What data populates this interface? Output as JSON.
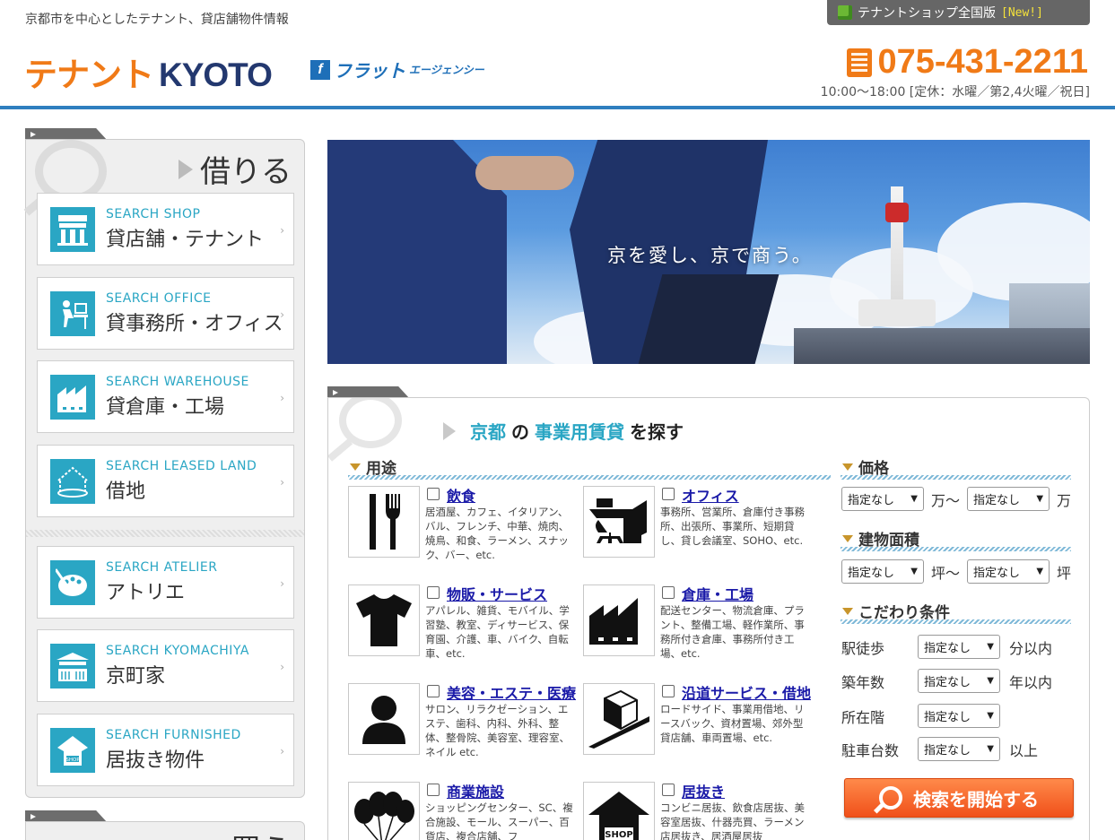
{
  "header": {
    "tagline": "京都市を中心としたテナント、貸店舗物件情報",
    "ribbon_label": "テナントショップ全国版",
    "ribbon_new": "[New!]",
    "logo_tenant": "テナント",
    "logo_kyoto": "KYOTO",
    "partner_logo": "フラット",
    "partner_logo_small": "エージェンシー",
    "phone": "075-431-2211",
    "hours": "10:00〜18:00 [定休：水曜／第2,4火曜／祝日]"
  },
  "sidebar": {
    "title": "借りる",
    "items": [
      {
        "en": "SEARCH SHOP",
        "jp": "貸店舗・テナント",
        "icon": "shop-icon"
      },
      {
        "en": "SEARCH OFFICE",
        "jp": "貸事務所・オフィス",
        "icon": "office-icon"
      },
      {
        "en": "SEARCH WAREHOUSE",
        "jp": "貸倉庫・工場",
        "icon": "factory-icon"
      },
      {
        "en": "SEARCH LEASED LAND",
        "jp": "借地",
        "icon": "land-icon"
      },
      {
        "en": "SEARCH ATELIER",
        "jp": "アトリエ",
        "icon": "palette-icon"
      },
      {
        "en": "SEARCH KYOMACHIYA",
        "jp": "京町家",
        "icon": "machiya-icon"
      },
      {
        "en": "SEARCH FURNISHED",
        "jp": "居抜き物件",
        "icon": "furnished-shop-icon"
      }
    ],
    "next_title": "買う"
  },
  "hero": {
    "caption": "京を愛し、京で商う。"
  },
  "search": {
    "title_a": "京都",
    "title_b": "の",
    "title_c": "事業用賃貸",
    "title_d": "を探す",
    "use_heading": "用途",
    "uses": [
      {
        "name": "飲食",
        "desc": "居酒屋、カフェ、イタリアン、バル、フレンチ、中華、焼肉、焼鳥、和食、ラーメン、スナック、バー、etc.",
        "icon": "fork-knife-icon"
      },
      {
        "name": "オフィス",
        "desc": "事務所、営業所、倉庫付き事務所、出張所、事業所、短期貸し、貸し会議室、SOHO、etc.",
        "icon": "desk-icon"
      },
      {
        "name": "物販・サービス",
        "desc": "アパレル、雑貨、モバイル、学習塾、教室、ディサービス、保育園、介護、車、バイク、自転車、etc.",
        "icon": "tshirt-icon"
      },
      {
        "name": "倉庫・工場",
        "desc": "配送センター、物流倉庫、プラント、整備工場、軽作業所、事務所付き倉庫、事務所付き工場、etc.",
        "icon": "factory-icon"
      },
      {
        "name": "美容・エステ・医療",
        "desc": "サロン、リラクゼーション、エステ、歯科、内科、外科、整体、整骨院、美容室、理容室、ネイル etc.",
        "icon": "person-icon"
      },
      {
        "name": "沿道サービス・借地",
        "desc": "ロードサイド、事業用借地、リースバック、資材置場、郊外型貸店舗、車両置場、etc.",
        "icon": "roadside-icon"
      },
      {
        "name": "商業施設",
        "desc": "ショッピングセンター、SC、複合施設、モール、スーパー、百貨店、複合店舗、フ",
        "icon": "balloons-icon"
      },
      {
        "name": "居抜き",
        "desc": "コンビニ居抜、飲食店居抜、美容室居抜、什器売買、ラーメン店居抜き、居酒屋居抜",
        "icon": "shop-house-icon"
      }
    ],
    "price_heading": "価格",
    "price_from": "指定なし",
    "price_unit_from": "万〜",
    "price_to": "指定なし",
    "price_unit_to": "万",
    "area_heading": "建物面積",
    "area_from": "指定なし",
    "area_unit_from": "坪〜",
    "area_to": "指定なし",
    "area_unit_to": "坪",
    "cond_heading": "こだわり条件",
    "conditions": [
      {
        "label": "駅徒歩",
        "value": "指定なし",
        "suffix": "分以内"
      },
      {
        "label": "築年数",
        "value": "指定なし",
        "suffix": "年以内"
      },
      {
        "label": "所在階",
        "value": "指定なし",
        "suffix": ""
      },
      {
        "label": "駐車台数",
        "value": "指定なし",
        "suffix": "以上"
      }
    ],
    "button_label": "検索を開始する"
  },
  "colors": {
    "accent_orange": "#f07a17",
    "brand_navy": "#23386f",
    "teal": "#2aa6c4",
    "header_line": "#2f7fbf"
  }
}
